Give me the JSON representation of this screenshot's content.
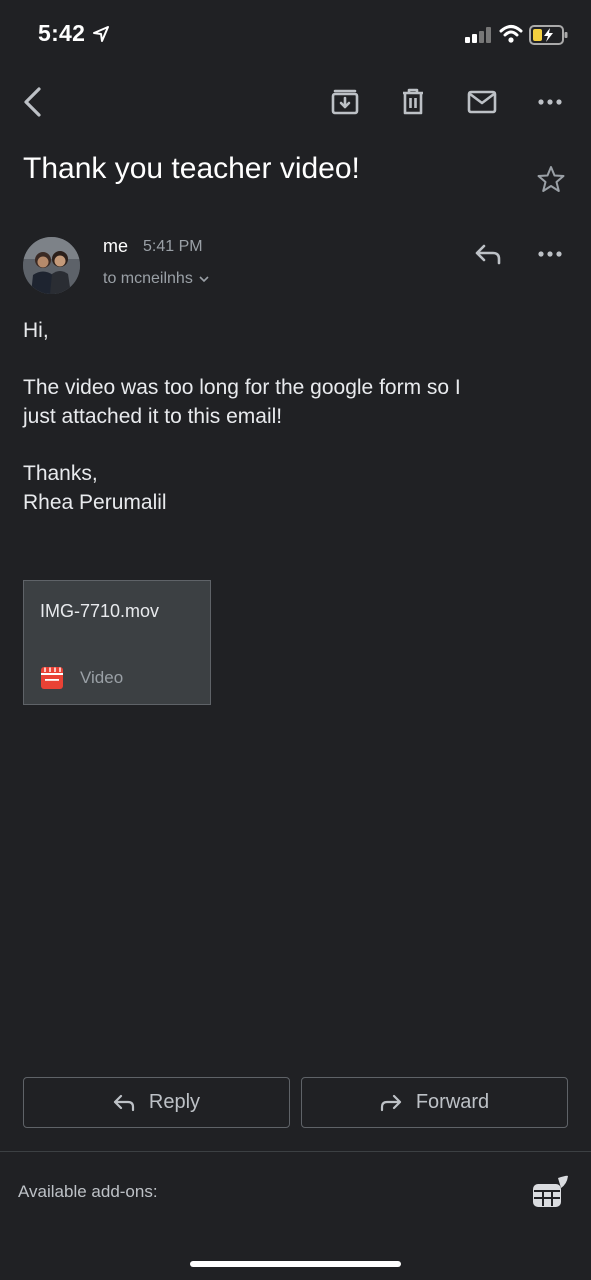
{
  "status_bar": {
    "time": "5:42"
  },
  "toolbar": {
    "icons": [
      "back-icon",
      "archive-icon",
      "trash-icon",
      "mark-unread-icon",
      "more-icon"
    ]
  },
  "email": {
    "subject": "Thank you teacher video!",
    "sender": "me",
    "time": "5:41 PM",
    "recipient": "to mcneilnhs",
    "body": {
      "greeting": "Hi,",
      "line1": "The video was too long for the google form so I",
      "line2": "just attached it to this email!",
      "signoff": "Thanks,",
      "signature": "Rhea Perumalil"
    },
    "attachment": {
      "filename": "IMG-7710.mov",
      "type": "Video"
    }
  },
  "actions": {
    "reply": "Reply",
    "forward": "Forward"
  },
  "footer": {
    "addons_label": "Available add-ons:"
  },
  "colors": {
    "background": "#202124",
    "attachment_bg": "#3c4043",
    "video_icon": "#e94235"
  }
}
